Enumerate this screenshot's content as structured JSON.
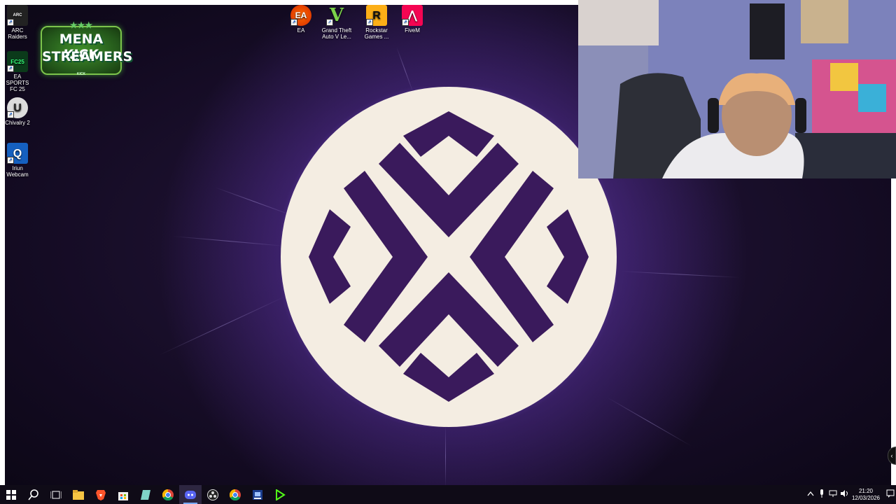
{
  "desktop_icons": [
    {
      "label": "ARC Raiders",
      "glyph": "ARC"
    },
    {
      "label": "EA SPORTS FC 25",
      "glyph": "FC25"
    },
    {
      "label": "Chivalry 2",
      "glyph": "U"
    },
    {
      "label": "Iriun Webcam",
      "glyph": "Q"
    },
    {
      "label": "EA",
      "glyph": "EA"
    },
    {
      "label": "Grand Theft Auto V Le...",
      "glyph": "V"
    },
    {
      "label": "Rockstar Games ...",
      "glyph": "R"
    },
    {
      "label": "FiveM",
      "glyph": "⋀"
    }
  ],
  "overlay_badge": {
    "stars": "★★★",
    "line1": "MENA KICK",
    "line2": "STREAMERS",
    "tiny": "KICK"
  },
  "taskbar": {
    "pinned": [
      "start-icon",
      "search-icon",
      "task-view-icon",
      "file-explorer-icon",
      "brave-browser-icon",
      "microsoft-store-icon",
      "notes-app-icon",
      "chrome-icon",
      "discord-icon",
      "obs-icon",
      "chrome-profile-icon",
      "app-window-icon",
      "kick-icon"
    ],
    "clock_time": "21:20",
    "clock_date": "12/03/2026"
  },
  "colors": {
    "wallpaper_dark": "#120a20",
    "logo_light": "#f4ede2",
    "logo_purple": "#3a1a5c",
    "badge_green": "#2f6d22"
  }
}
